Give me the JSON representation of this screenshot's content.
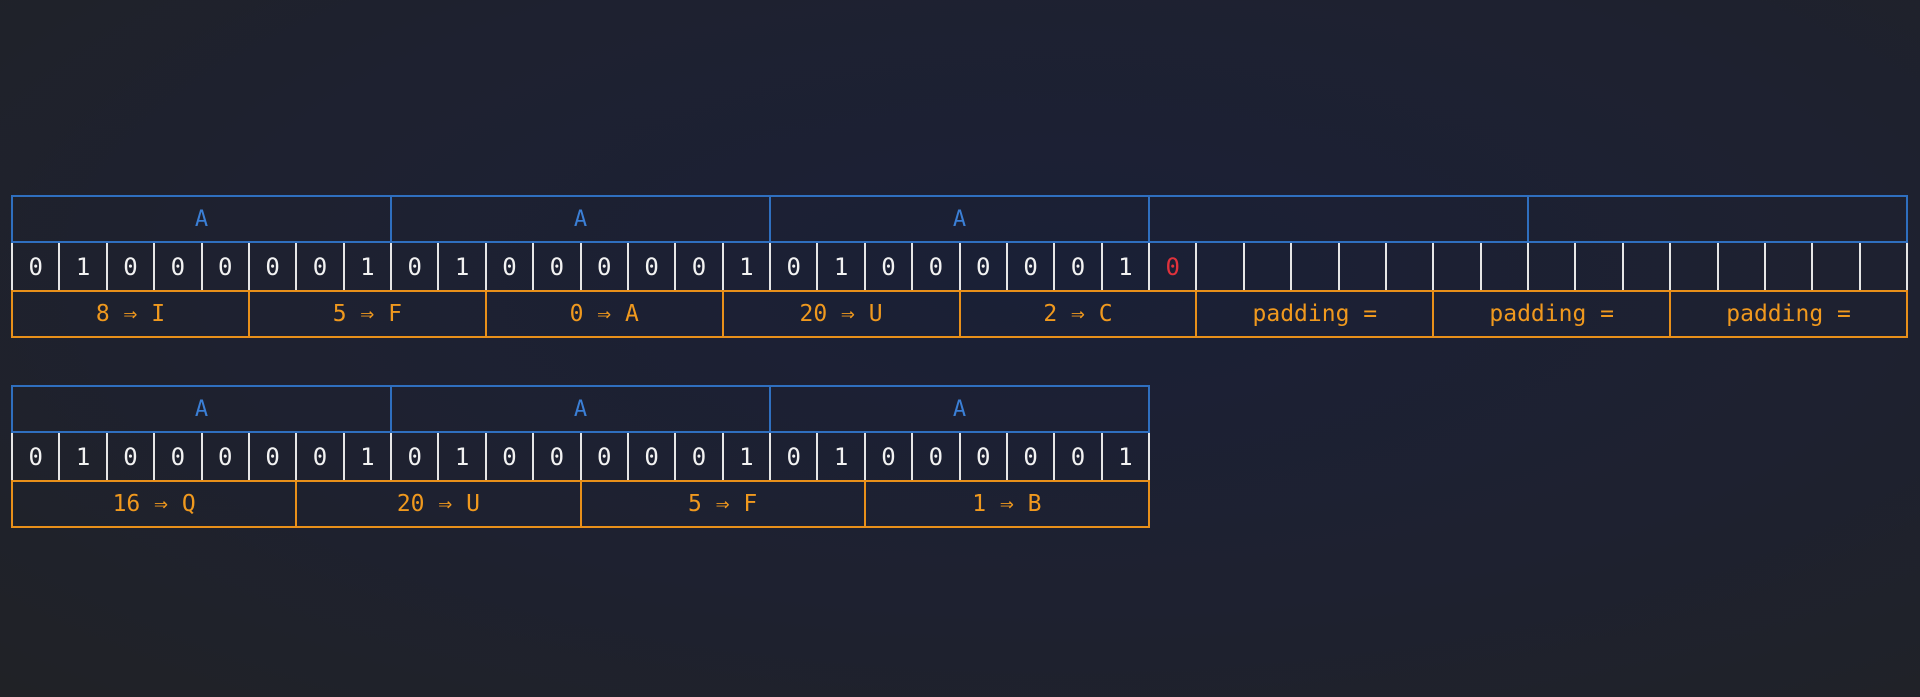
{
  "colors": {
    "byte_border": "#2f6fbf",
    "byte_text": "#3b7fd6",
    "bit_border": "#e6e6e6",
    "bit_text": "#f2f2f2",
    "extra_bit_text": "#e0323c",
    "char_border": "#e8901a",
    "char_text": "#f0991e"
  },
  "diagrams": [
    {
      "bytes": [
        "A",
        "A",
        "A",
        "",
        ""
      ],
      "bits": [
        "0",
        "1",
        "0",
        "0",
        "0",
        "0",
        "0",
        "1",
        "0",
        "1",
        "0",
        "0",
        "0",
        "0",
        "0",
        "1",
        "0",
        "1",
        "0",
        "0",
        "0",
        "0",
        "0",
        "1",
        "0",
        "",
        "",
        "",
        "",
        "",
        "",
        "",
        "",
        "",
        "",
        "",
        "",
        "",
        "",
        ""
      ],
      "extra_bit_index": 24,
      "chars": [
        "8 ⇒ I",
        "5 ⇒ F",
        "0 ⇒ A",
        "20 ⇒ U",
        "2 ⇒ C",
        "padding =",
        "padding =",
        "padding ="
      ]
    },
    {
      "bytes": [
        "A",
        "A",
        "A"
      ],
      "bits": [
        "0",
        "1",
        "0",
        "0",
        "0",
        "0",
        "0",
        "1",
        "0",
        "1",
        "0",
        "0",
        "0",
        "0",
        "0",
        "1",
        "0",
        "1",
        "0",
        "0",
        "0",
        "0",
        "0",
        "1"
      ],
      "extra_bit_index": -1,
      "chars": [
        "16 ⇒ Q",
        "20 ⇒ U",
        "5 ⇒ F",
        "1 ⇒ B"
      ]
    }
  ]
}
